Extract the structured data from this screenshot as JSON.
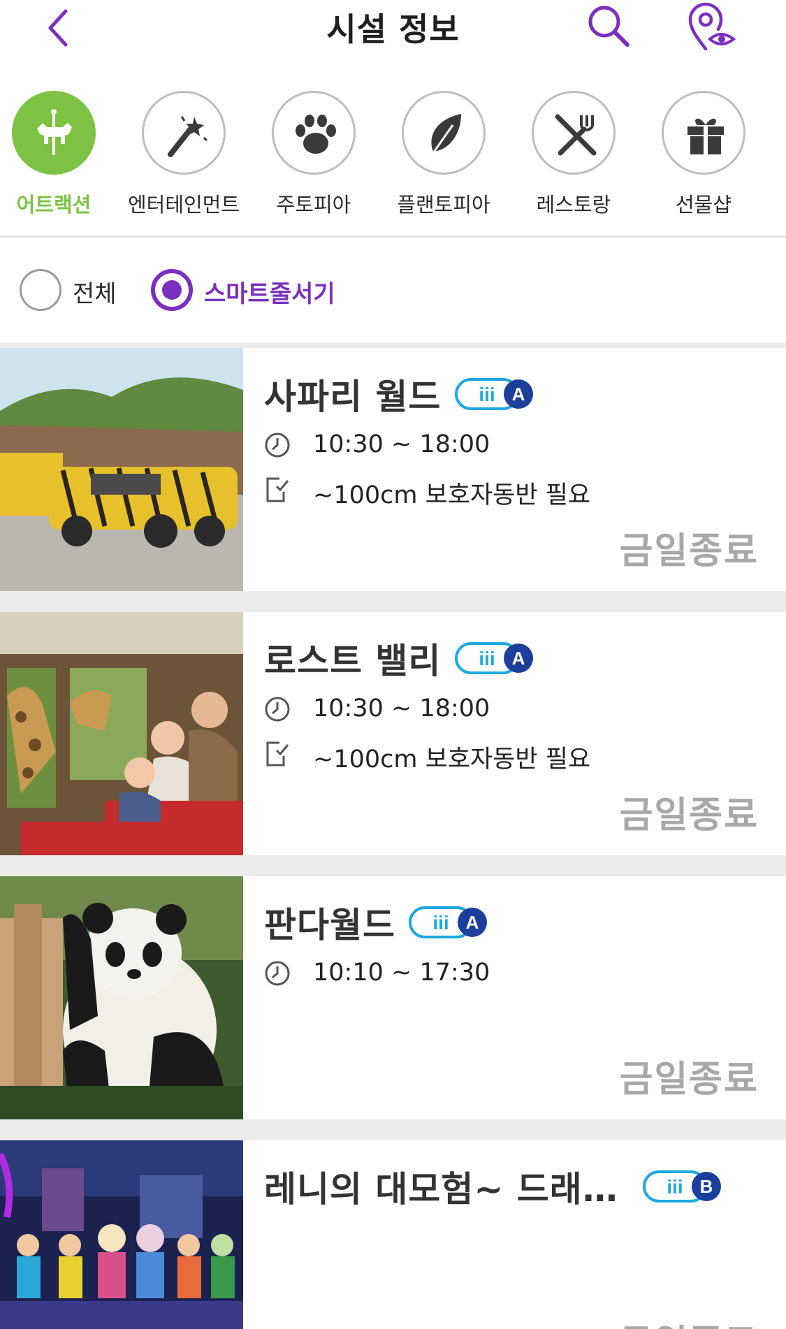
{
  "header": {
    "title": "시설 정보",
    "back_icon": "chevron-left-icon",
    "search_icon": "search-icon",
    "map_icon": "map-pin-eye-icon",
    "accent_color": "#7b2fbf"
  },
  "categories": [
    {
      "label": "어트랙션",
      "icon": "carousel-horse-icon",
      "active": true
    },
    {
      "label": "엔터테인먼트",
      "icon": "magic-wand-icon",
      "active": false
    },
    {
      "label": "주토피아",
      "icon": "paw-icon",
      "active": false
    },
    {
      "label": "플랜토피아",
      "icon": "leaf-icon",
      "active": false
    },
    {
      "label": "레스토랑",
      "icon": "fork-knife-icon",
      "active": false
    },
    {
      "label": "선물샵",
      "icon": "gift-icon",
      "active": false
    }
  ],
  "category_active_color": "#7dc242",
  "filter": {
    "options": [
      {
        "label": "전체",
        "checked": false
      },
      {
        "label": "스마트줄서기",
        "checked": true
      }
    ]
  },
  "facilities": [
    {
      "name": "사파리 월드",
      "badge_letter": "A",
      "hours": "10:30 ~ 18:00",
      "requirement": "~100cm 보호자동반 필요",
      "status": "금일종료",
      "image": "safari-truck-photo"
    },
    {
      "name": "로스트 밸리",
      "badge_letter": "A",
      "hours": "10:30 ~ 18:00",
      "requirement": "~100cm 보호자동반 필요",
      "status": "금일종료",
      "image": "giraffe-bus-photo"
    },
    {
      "name": "판다월드",
      "badge_letter": "A",
      "hours": "10:10 ~ 17:30",
      "status": "금일종료",
      "image": "panda-photo"
    },
    {
      "name": "레니의 대모험~ 드래…",
      "badge_letter": "B",
      "status": "금일종료",
      "image": "stage-show-photo"
    }
  ],
  "icons": {
    "clock": "clock-icon",
    "notice": "checklist-icon",
    "badge": "smart-queue-badge-icon"
  }
}
